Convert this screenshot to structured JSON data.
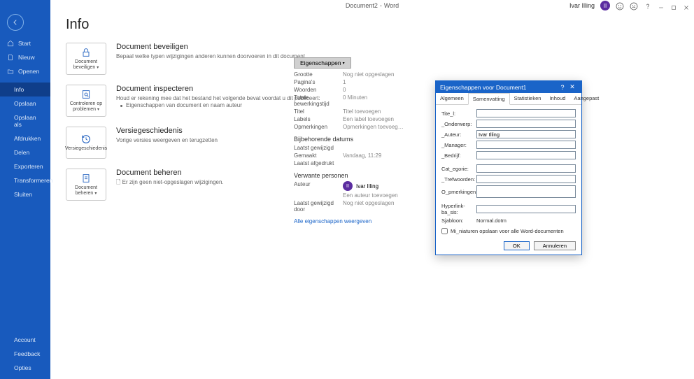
{
  "app": {
    "doc": "Document2",
    "sep": "-",
    "name": "Word"
  },
  "user": {
    "name": "Ivar Illing",
    "initials": "II"
  },
  "sidebar": {
    "items": [
      {
        "label": "Start"
      },
      {
        "label": "Nieuw"
      },
      {
        "label": "Openen"
      },
      {
        "label": "Info"
      },
      {
        "label": "Opslaan"
      },
      {
        "label": "Opslaan als"
      },
      {
        "label": "Afdrukken"
      },
      {
        "label": "Delen"
      },
      {
        "label": "Exporteren"
      },
      {
        "label": "Transformeren"
      },
      {
        "label": "Sluiten"
      }
    ],
    "footer": [
      {
        "label": "Account"
      },
      {
        "label": "Feedback"
      },
      {
        "label": "Opties"
      }
    ]
  },
  "page": {
    "title": "Info",
    "sections": [
      {
        "card": "Document beveiligen",
        "title": "Document beveiligen",
        "body": "Bepaal welke typen wijzigingen anderen kunnen doorvoeren in dit document."
      },
      {
        "card": "Controleren op problemen",
        "title": "Document inspecteren",
        "body": "Houd er rekening mee dat het bestand het volgende bevat voordat u dit publiceert:",
        "bullet": "Eigenschappen van document en naam auteur"
      },
      {
        "card": "Versiegeschiedenis",
        "title": "Versiegeschiedenis",
        "body": "Vorige versies weergeven en terugzetten"
      },
      {
        "card": "Document beheren",
        "title": "Document beheren",
        "body": "Er zijn geen niet-opgeslagen wijzigingen."
      }
    ]
  },
  "props": {
    "button": "Eigenschappen",
    "rows": [
      {
        "k": "Grootte",
        "v": "Nog niet opgeslagen"
      },
      {
        "k": "Pagina's",
        "v": "1"
      },
      {
        "k": "Woorden",
        "v": "0"
      },
      {
        "k": "Totale bewerkingstijd",
        "v": "0 Minuten"
      },
      {
        "k": "Titel",
        "v": "Titel toevoegen"
      },
      {
        "k": "Labels",
        "v": "Een label toevoegen"
      },
      {
        "k": "Opmerkingen",
        "v": "Opmerkingen toevoeg…"
      }
    ],
    "dates_h": "Bijbehorende datums",
    "dates": [
      {
        "k": "Laatst gewijzigd",
        "v": ""
      },
      {
        "k": "Gemaakt",
        "v": "Vandaag, 11:29"
      },
      {
        "k": "Laatst afgedrukt",
        "v": ""
      }
    ],
    "people_h": "Verwante personen",
    "author_k": "Auteur",
    "author_v": "Ivar Illing",
    "add_author": "Een auteur toevoegen",
    "lastmod_k": "Laatst gewijzigd door",
    "lastmod_v": "Nog niet opgeslagen",
    "all_link": "Alle eigenschappen weergeven"
  },
  "dialog": {
    "title": "Eigenschappen voor Document1",
    "tabs": [
      "Algemeen",
      "Samenvatting",
      "Statistieken",
      "Inhoud",
      "Aangepast"
    ],
    "fields": {
      "titel": "Tite_l:",
      "onderwerp": "_Onderwerp:",
      "auteur": "_Auteur:",
      "auteur_v": "Ivar Illing",
      "manager": "_Manager:",
      "bedrijf": "_Bedrijf:",
      "categorie": "Cat_egorie:",
      "trefwoorden": "_Trefwoorden:",
      "opmerkingen": "O_pmerkingen:",
      "hyperlink": "Hyperlink-ba_sis:",
      "sjabloon_k": "Sjabloon:",
      "sjabloon_v": "Normal.dotm"
    },
    "thumb": "Mi_niaturen opslaan voor alle Word-documenten",
    "ok": "OK",
    "cancel": "Annuleren"
  }
}
